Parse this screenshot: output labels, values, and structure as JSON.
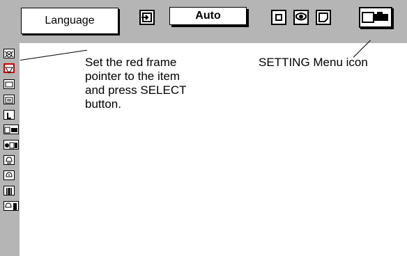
{
  "menubar": {
    "language_label": "Language",
    "auto_label": "Auto",
    "icons": [
      "input-icon",
      "image-select-icon",
      "image-adjust-icon",
      "screen-icon",
      "setting-menu-icon"
    ]
  },
  "sidebar": {
    "items": [
      "projector-setting-icon",
      "selected-frame-icon",
      "screen-item-icon",
      "menu-item-icon",
      "logo-item-icon",
      "ceiling-icon",
      "rear-icon",
      "lamp-icon",
      "power-icon",
      "filter-icon",
      "lamp-counter-icon"
    ],
    "selected_index": 1,
    "selected_color": "#cc0000"
  },
  "annotations": {
    "instruction_lines": [
      "Set the red frame",
      "pointer to the item",
      "and press SELECT",
      "button."
    ],
    "setting_menu_icon_label": "SETTING Menu icon"
  }
}
